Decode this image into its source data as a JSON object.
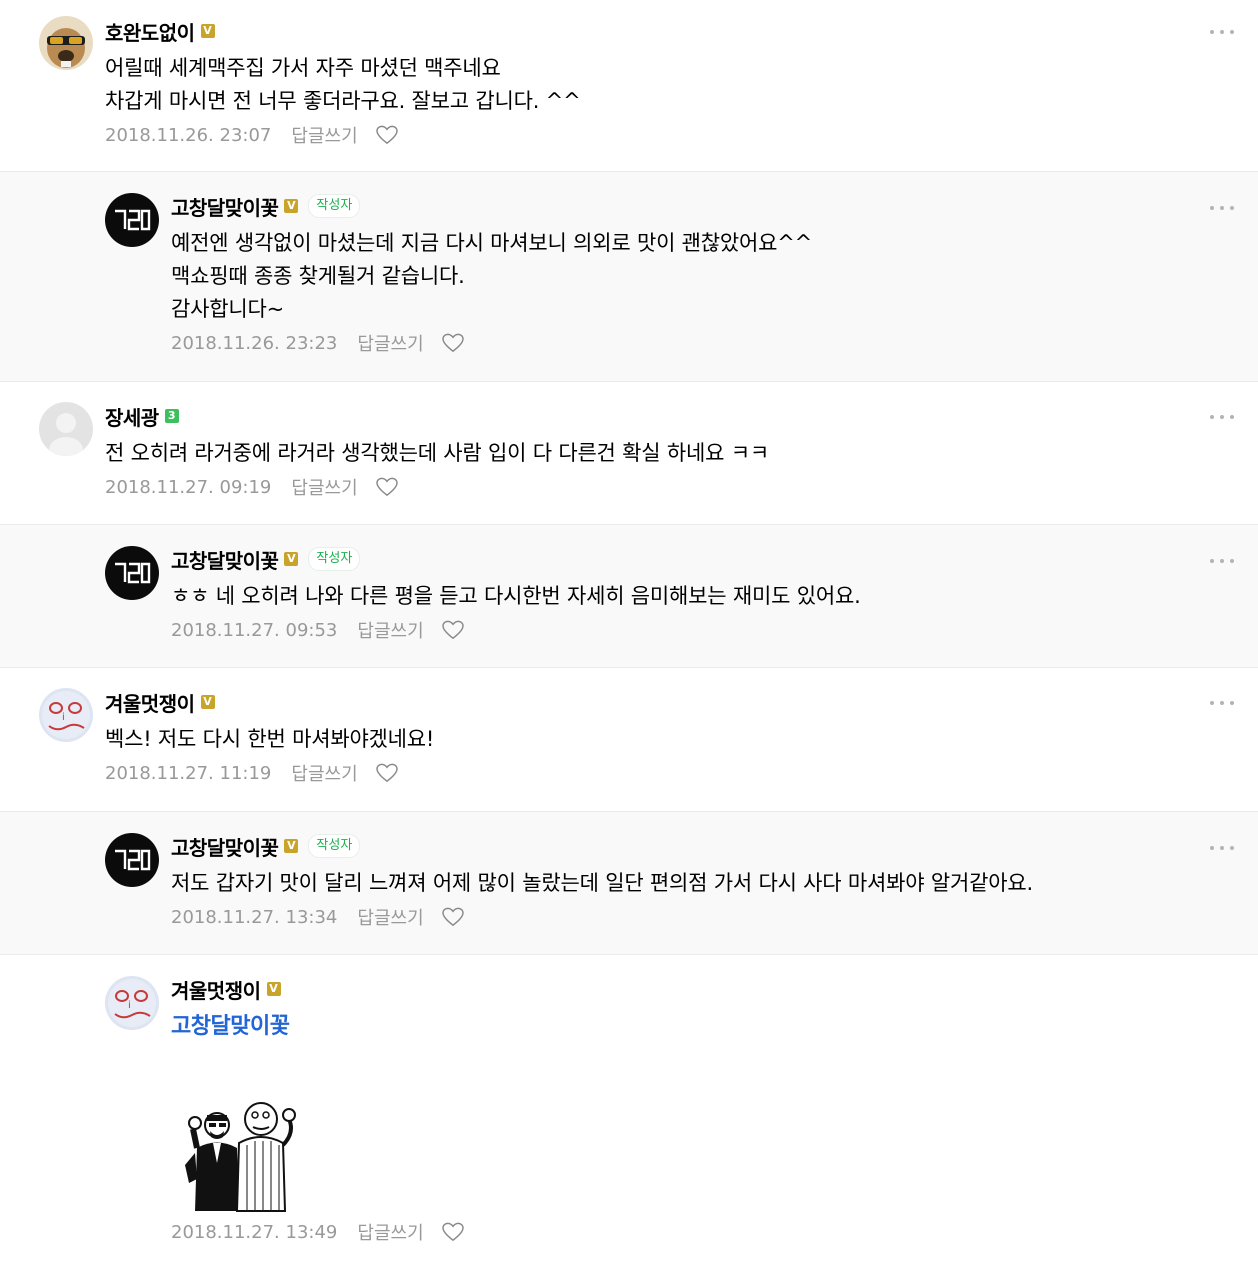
{
  "ui": {
    "reply_label": "답글쓰기",
    "author_tag": "작성자"
  },
  "comments": [
    {
      "nickname": "호완도없이",
      "badge": "V",
      "text": "어릴때 세계맥주집 가서 자주 마셨던 맥주네요\n차갑게 마시면 전 너무 좋더라구요. 잘보고 갑니다. ^^",
      "date": "2018.11.26. 23:07",
      "avatar_icon": "bulldog-sunglasses-avatar-icon"
    },
    {
      "nickname": "고창달맞이꽃",
      "badge": "V",
      "text": "예전엔 생각없이 마셨는데 지금 다시 마셔보니 의외로 맛이 괜찮았어요^^\n맥쇼핑때 종종 찾게될거 같습니다.\n감사합니다~",
      "date": "2018.11.26. 23:23",
      "avatar_icon": "gcd-logo-avatar-icon"
    },
    {
      "nickname": "장세광",
      "badge": "3",
      "text": "전 오히려 라거중에 라거라 생각했는데 사람 입이 다 다른건 확실 하네요 ㅋㅋ",
      "date": "2018.11.27. 09:19",
      "avatar_icon": "default-user-avatar-icon"
    },
    {
      "nickname": "고창달맞이꽃",
      "badge": "V",
      "text": "ㅎㅎ 네 오히려 나와 다른 평을 듣고 다시한번 자세히 음미해보는 재미도 있어요.",
      "date": "2018.11.27. 09:53",
      "avatar_icon": "gcd-logo-avatar-icon"
    },
    {
      "nickname": "겨울멋쟁이",
      "badge": "V",
      "text": "벡스! 저도 다시 한번 마셔봐야겠네요!",
      "date": "2018.11.27. 11:19",
      "avatar_icon": "doodle-face-avatar-icon"
    },
    {
      "nickname": "고창달맞이꽃",
      "badge": "V",
      "text": "저도 갑자기 맛이 달리 느껴져 어제 많이 놀랐는데 일단 편의점 가서 다시 사다 마셔봐야 알거같아요.",
      "date": "2018.11.27. 13:34",
      "avatar_icon": "gcd-logo-avatar-icon"
    },
    {
      "nickname": "겨울멋쟁이",
      "badge": "V",
      "mention": "고창달맞이꽃",
      "date": "2018.11.27. 13:49",
      "avatar_icon": "doodle-face-avatar-icon",
      "sticker": "two-men-ok-gesture-sticker"
    }
  ]
}
